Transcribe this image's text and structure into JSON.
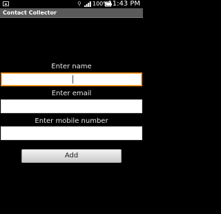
{
  "status_bar": {
    "battery_percent": "100%",
    "time": "11:43 PM",
    "icons": [
      "notification-icon",
      "usb-icon",
      "signal-icon",
      "battery-icon"
    ]
  },
  "app": {
    "title": "Contact Collector"
  },
  "form": {
    "name_label": "Enter name",
    "name_value": "",
    "email_label": "Enter email",
    "email_value": "",
    "mobile_label": "Enter mobile number",
    "mobile_value": "",
    "add_label": "Add"
  },
  "colors": {
    "focus_accent": "#ff8a00",
    "title_bar": "#5a5a5a",
    "background": "#000000"
  }
}
